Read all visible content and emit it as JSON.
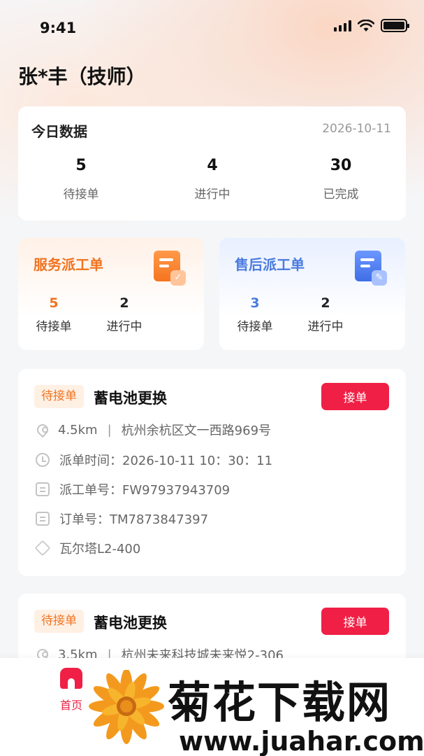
{
  "status_bar": {
    "time": "9:41"
  },
  "user": {
    "name": "张*丰（技师）"
  },
  "today": {
    "title": "今日数据",
    "date": "2026-10-11",
    "stats": [
      {
        "value": "5",
        "label": "待接单"
      },
      {
        "value": "4",
        "label": "进行中"
      },
      {
        "value": "30",
        "label": "已完成"
      }
    ]
  },
  "dispatch": {
    "service": {
      "title": "服务派工单",
      "stats": [
        {
          "value": "5",
          "label": "待接单"
        },
        {
          "value": "2",
          "label": "进行中"
        }
      ],
      "accent": "#f0731f"
    },
    "after_sales": {
      "title": "售后派工单",
      "stats": [
        {
          "value": "3",
          "label": "待接单"
        },
        {
          "value": "2",
          "label": "进行中"
        }
      ],
      "accent": "#4a7be0"
    }
  },
  "orders": [
    {
      "tag": "待接单",
      "name": "蓄电池更换",
      "accept_label": "接单",
      "distance": "4.5km",
      "separator": "|",
      "address": "杭州余杭区文一西路969号",
      "dispatch_time": "派单时间：2026-10-11 10：30：11",
      "work_order_no": "派工单号：FW97937943709",
      "order_no": "订单号：TM7873847397",
      "product": "瓦尔塔L2-400"
    },
    {
      "tag": "待接单",
      "name": "蓄电池更换",
      "accept_label": "接单",
      "distance": "3.5km",
      "separator": "|",
      "address": "杭州未来科技城未来悦2-306"
    }
  ],
  "tabbar": {
    "home_label": "首页",
    "accent": "#f01f45"
  },
  "watermark": {
    "title": "菊花下载网",
    "url": "www.juahar.com"
  }
}
